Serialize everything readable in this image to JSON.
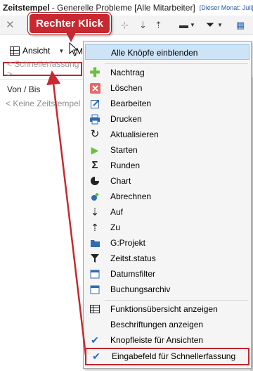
{
  "window": {
    "title_bold": "Zeitstempel",
    "title_rest": " - Generelle Probleme [Alle Mitarbeiter]",
    "month_info": "[Dieser Monat: Juli]"
  },
  "callout": {
    "text": "Rechter Klick"
  },
  "toolbar2": {
    "view_label": "Ansicht",
    "mi_label": "Mi"
  },
  "quick_entry": {
    "placeholder": "< Schnellerfassung >"
  },
  "grid": {
    "column_header": "Von / Bis",
    "empty_text": "< Keine Zeitstempel >"
  },
  "context_menu": {
    "items": [
      {
        "label": "Alle Knöpfe einblenden",
        "icon": "none"
      },
      {
        "label": "Nachtrag",
        "icon": "plus-icon"
      },
      {
        "label": "Löschen",
        "icon": "delete-icon"
      },
      {
        "label": "Bearbeiten",
        "icon": "edit-icon"
      },
      {
        "label": "Drucken",
        "icon": "printer-icon"
      },
      {
        "label": "Aktualisieren",
        "icon": "refresh-icon"
      },
      {
        "label": "Starten",
        "icon": "play-icon"
      },
      {
        "label": "Runden",
        "icon": "sigma-icon"
      },
      {
        "label": "Chart",
        "icon": "pie-chart-icon"
      },
      {
        "label": "Abrechnen",
        "icon": "billing-icon"
      },
      {
        "label": "Auf",
        "icon": "sort-up-icon"
      },
      {
        "label": "Zu",
        "icon": "sort-down-icon"
      },
      {
        "label": "G:Projekt",
        "icon": "folder-icon"
      },
      {
        "label": "Zeitst.status",
        "icon": "filter-icon"
      },
      {
        "label": "Datumsfilter",
        "icon": "calendar-icon"
      },
      {
        "label": "Buchungsarchiv",
        "icon": "archive-icon"
      },
      {
        "label": "Funktionsübersicht anzeigen",
        "icon": "table-icon"
      },
      {
        "label": "Beschriftungen anzeigen",
        "icon": "none"
      },
      {
        "label": "Knopfleiste für Ansichten",
        "icon": "check-icon"
      },
      {
        "label": "Eingabefeld für Schnellerfassung",
        "icon": "check-icon"
      }
    ]
  },
  "colors": {
    "accent_red": "#c8282f",
    "menu_highlight": "#cde4f7",
    "green": "#6cbf3b",
    "blue": "#2f6ab3"
  }
}
